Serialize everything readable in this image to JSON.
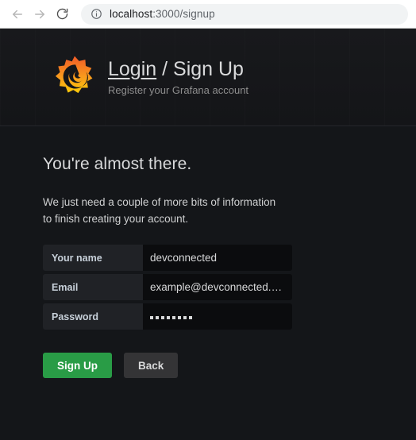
{
  "browser": {
    "back_label": "Back",
    "forward_label": "Forward",
    "reload_label": "Reload",
    "site_info_label": "View site information",
    "url_host": "localhost",
    "url_path": ":3000/signup"
  },
  "header": {
    "logo_name": "grafana-logo",
    "title_login": "Login",
    "title_separator": " / ",
    "title_signup": "Sign Up",
    "subtitle": "Register your Grafana account"
  },
  "main": {
    "headline": "You're almost there.",
    "blurb": "We just need a couple of more bits of information to finish creating your account.",
    "form": {
      "fields": [
        {
          "label": "Your name",
          "value": "devconnected",
          "type": "text"
        },
        {
          "label": "Email",
          "value": "example@devconnected.c…",
          "type": "email"
        },
        {
          "label": "Password",
          "value": "••••••••",
          "type": "password",
          "dots": 8
        }
      ]
    },
    "buttons": {
      "submit": "Sign Up",
      "back": "Back"
    }
  },
  "colors": {
    "accent_green": "#299c46",
    "logo_orange": "#f05a28",
    "logo_yellow": "#fbca0a",
    "page_bg": "#141619",
    "label_bg": "#202226",
    "input_bg": "#0b0c0e"
  }
}
